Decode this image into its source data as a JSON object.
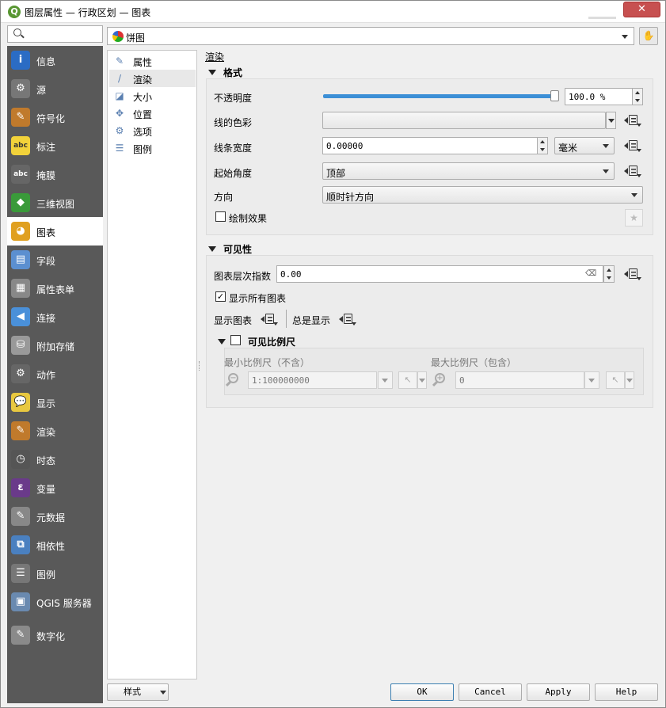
{
  "window": {
    "title": "图层属性 — 行政区划 — 图表",
    "close_icon": "close-icon"
  },
  "search": {
    "placeholder": ""
  },
  "sidebar": {
    "items": [
      {
        "label": "信息",
        "icon": "info-icon",
        "color": "#2b6cc4",
        "glyph": "i"
      },
      {
        "label": "源",
        "icon": "source-icon",
        "color": "#777777",
        "glyph": "⚙"
      },
      {
        "label": "符号化",
        "icon": "symbology-icon",
        "color": "#c07a2c",
        "glyph": "✎"
      },
      {
        "label": "标注",
        "icon": "labels-icon",
        "color": "#f2d23a",
        "glyph": "abc"
      },
      {
        "label": "掩膜",
        "icon": "mask-icon",
        "color": "#666666",
        "glyph": "abc"
      },
      {
        "label": "三维视图",
        "icon": "3d-view-icon",
        "color": "#3a9a3a",
        "glyph": "◆"
      },
      {
        "label": "图表",
        "icon": "diagram-icon",
        "color": "#e0a020",
        "glyph": "◕"
      },
      {
        "label": "字段",
        "icon": "fields-icon",
        "color": "#5b8fd0",
        "glyph": "▤"
      },
      {
        "label": "属性表单",
        "icon": "attributes-form-icon",
        "color": "#888888",
        "glyph": "▦"
      },
      {
        "label": "连接",
        "icon": "joins-icon",
        "color": "#4a90d9",
        "glyph": "◀"
      },
      {
        "label": "附加存储",
        "icon": "auxiliary-storage-icon",
        "color": "#999999",
        "glyph": "⛁"
      },
      {
        "label": "动作",
        "icon": "actions-icon",
        "color": "#666666",
        "glyph": "⚙"
      },
      {
        "label": "显示",
        "icon": "display-icon",
        "color": "#e8c840",
        "glyph": "💬"
      },
      {
        "label": "渲染",
        "icon": "rendering-icon",
        "color": "#c07a2c",
        "glyph": "✎"
      },
      {
        "label": "时态",
        "icon": "temporal-icon",
        "color": "#555555",
        "glyph": "◷"
      },
      {
        "label": "变量",
        "icon": "variables-icon",
        "color": "#6a3a8a",
        "glyph": "ε"
      },
      {
        "label": "元数据",
        "icon": "metadata-icon",
        "color": "#888888",
        "glyph": "✎"
      },
      {
        "label": "相依性",
        "icon": "dependencies-icon",
        "color": "#4a80c0",
        "glyph": "⧉"
      },
      {
        "label": "图例",
        "icon": "legend-icon",
        "color": "#777777",
        "glyph": "☰"
      },
      {
        "label": "QGIS 服务器",
        "icon": "qgis-server-icon",
        "color": "#6a8ab0",
        "glyph": "▣"
      },
      {
        "label": "数字化",
        "icon": "digitizing-icon",
        "color": "#8a8a8a",
        "glyph": "✎"
      }
    ],
    "selected_index": 6
  },
  "layer": {
    "type": "饼图",
    "icon": "pie-chart-icon"
  },
  "categories": {
    "items": [
      {
        "label": "属性",
        "icon": "attributes-brush-icon",
        "glyph": "✎"
      },
      {
        "label": "渲染",
        "icon": "rendering-brush-icon",
        "glyph": "/"
      },
      {
        "label": "大小",
        "icon": "size-icon",
        "glyph": "◪"
      },
      {
        "label": "位置",
        "icon": "placement-icon",
        "glyph": "✥"
      },
      {
        "label": "选项",
        "icon": "options-icon",
        "glyph": "⚙"
      },
      {
        "label": "图例",
        "icon": "legend-icon",
        "glyph": "☰"
      }
    ],
    "selected_index": 1
  },
  "panel": {
    "heading": "渲染"
  },
  "format": {
    "title": "格式",
    "opacity_label": "不透明度",
    "opacity_value": "100.0 %",
    "opacity": 1.0,
    "line_color_label": "线的色彩",
    "line_width_label": "线条宽度",
    "line_width_value": "0.00000",
    "line_width_unit": "毫米",
    "start_angle_label": "起始角度",
    "start_angle_value": "顶部",
    "direction_label": "方向",
    "direction_value": "顺时针方向",
    "draw_effects_label": "绘制效果",
    "draw_effects_checked": false
  },
  "visibility": {
    "title": "可见性",
    "z_index_label": "图表层次指数",
    "z_index_value": "0.00",
    "show_all_label": "显示所有图表",
    "show_all_checked": true,
    "show_diagram_label": "显示图表",
    "always_show_label": "总是显示",
    "scale": {
      "title": "可见比例尺",
      "checked": false,
      "min_label": "最小比例尺（不含）",
      "min_value": "1:100000000",
      "max_label": "最大比例尺（包含）",
      "max_value": "0"
    }
  },
  "buttons": {
    "style": "样式",
    "ok": "OK",
    "cancel": "Cancel",
    "apply": "Apply",
    "help": "Help"
  }
}
